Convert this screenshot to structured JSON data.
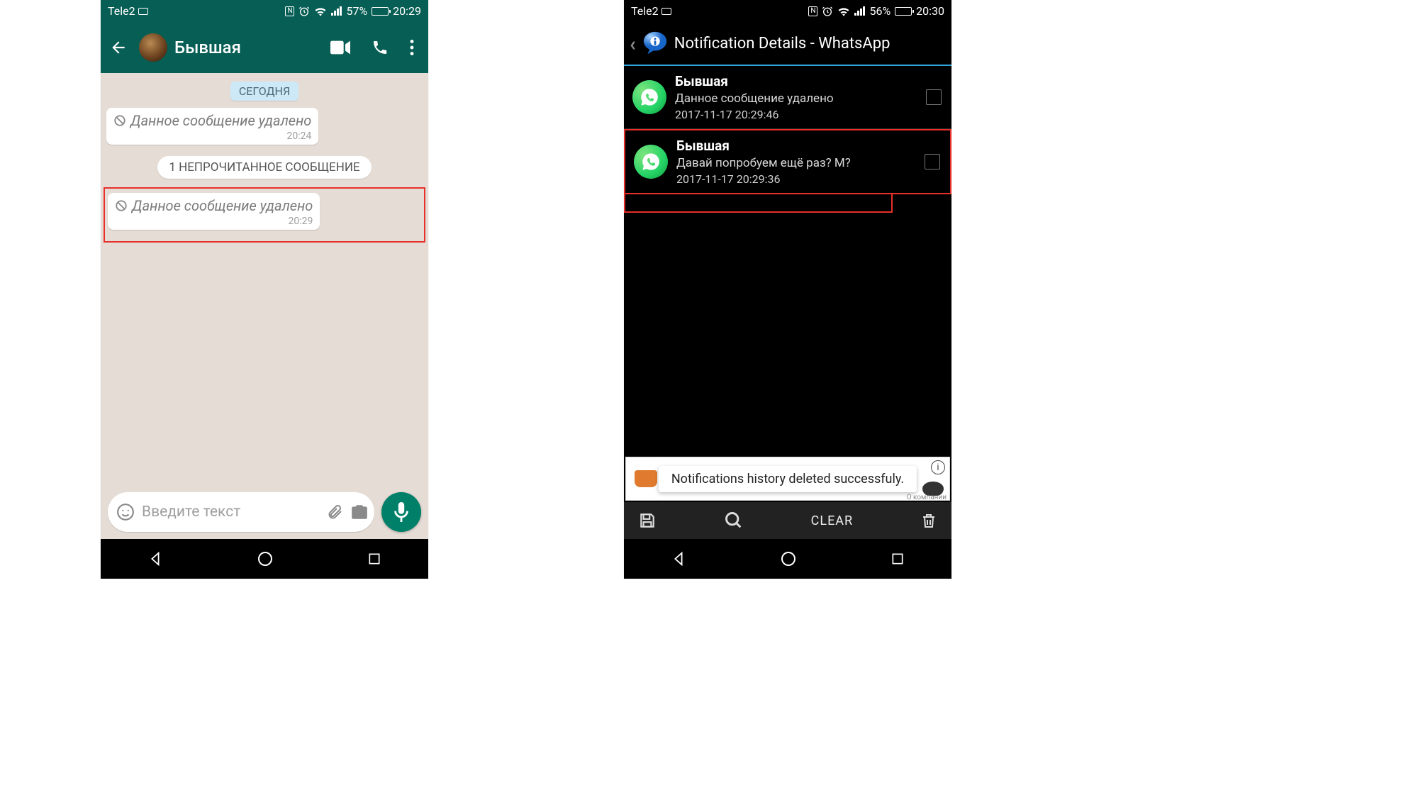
{
  "left": {
    "status": {
      "carrier": "Tele2",
      "battery_pct": "57%",
      "time": "20:29"
    },
    "contact_name": "Бывшая",
    "date_label": "СЕГОДНЯ",
    "messages": [
      {
        "text": "Данное сообщение удалено",
        "time": "20:24",
        "highlighted": false
      },
      {
        "unread_label": "1 НЕПРОЧИТАННОЕ СООБЩЕНИЕ"
      },
      {
        "text": "Данное сообщение удалено",
        "time": "20:29",
        "highlighted": true
      }
    ],
    "input_placeholder": "Введите текст"
  },
  "right": {
    "status": {
      "carrier": "Tele2",
      "battery_pct": "56%",
      "time": "20:30"
    },
    "header_title": "Notification Details - WhatsApp",
    "notifications": [
      {
        "sender": "Бывшая",
        "body": "Данное сообщение удалено",
        "ts": "2017-11-17 20:29:46",
        "highlighted": false
      },
      {
        "sender": "Бывшая",
        "body": "Давай попробуем ещё раз? М?",
        "ts": "2017-11-17 20:29:36",
        "highlighted": true
      }
    ],
    "toast_text": "Notifications history deleted successfuly.",
    "ad_footer": "О компании",
    "clear_label": "CLEAR"
  }
}
